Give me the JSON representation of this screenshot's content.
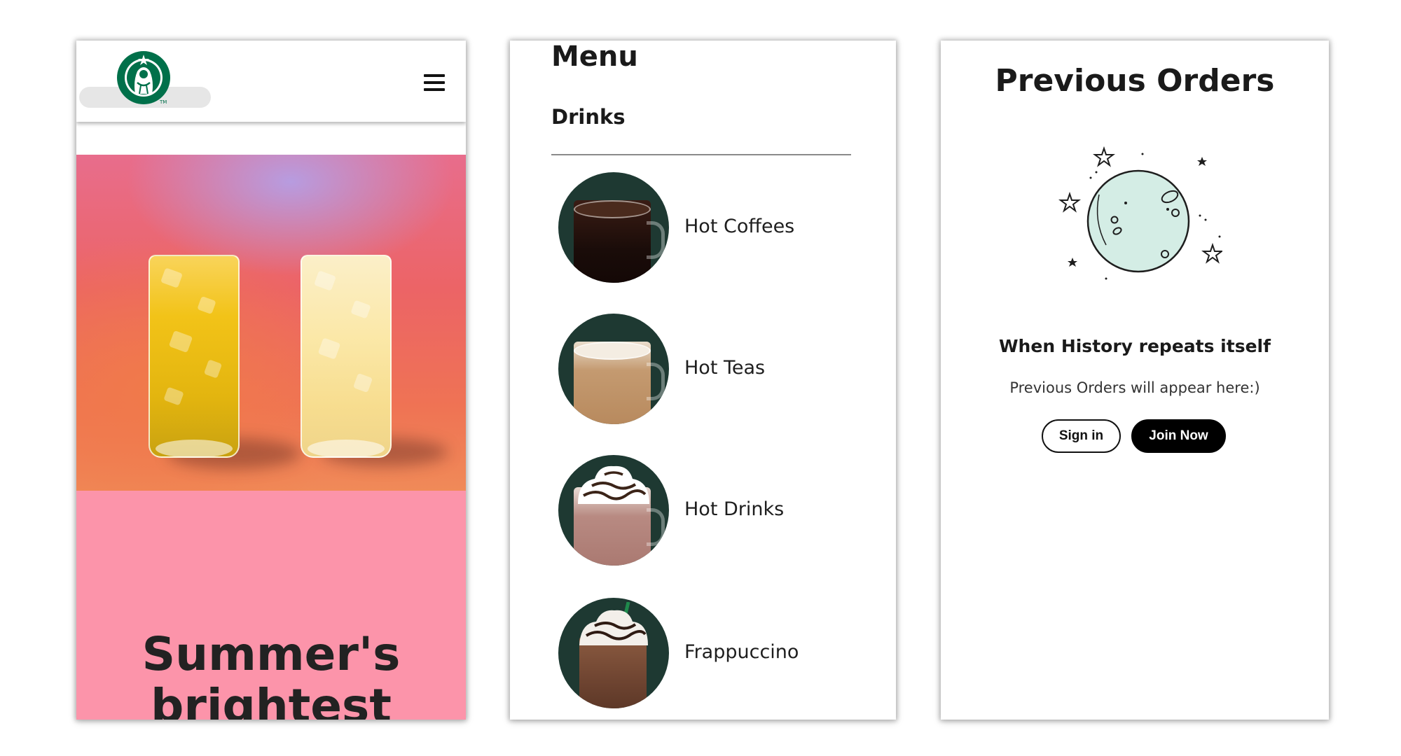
{
  "home": {
    "brand_icon": "starbucks-siren-logo",
    "menu_icon": "hamburger-menu-icon",
    "hero_image": "two-iced-refreshers-photo",
    "headline_line1": "Summer's",
    "headline_line2": "brightest"
  },
  "menu": {
    "title": "Menu",
    "section": "Drinks",
    "items": [
      {
        "label": "Hot Coffees",
        "image": "black-coffee-mug"
      },
      {
        "label": "Hot Teas",
        "image": "tea-latte-mug"
      },
      {
        "label": "Hot Drinks",
        "image": "hot-chocolate-whipped-mug"
      },
      {
        "label": "Frappuccino",
        "image": "mocha-frappuccino-cup"
      }
    ]
  },
  "orders": {
    "title": "Previous Orders",
    "illustration": "moon-and-stars",
    "heading": "When History repeats itself",
    "message": "Previous Orders will appear here:)",
    "sign_in_label": "Sign in",
    "join_label": "Join Now"
  },
  "colors": {
    "starbucks_green": "#1e3932",
    "logo_green": "#00704a",
    "promo_pink": "#fc94aa",
    "moon_fill": "#d4ede5",
    "button_black": "#000000"
  }
}
